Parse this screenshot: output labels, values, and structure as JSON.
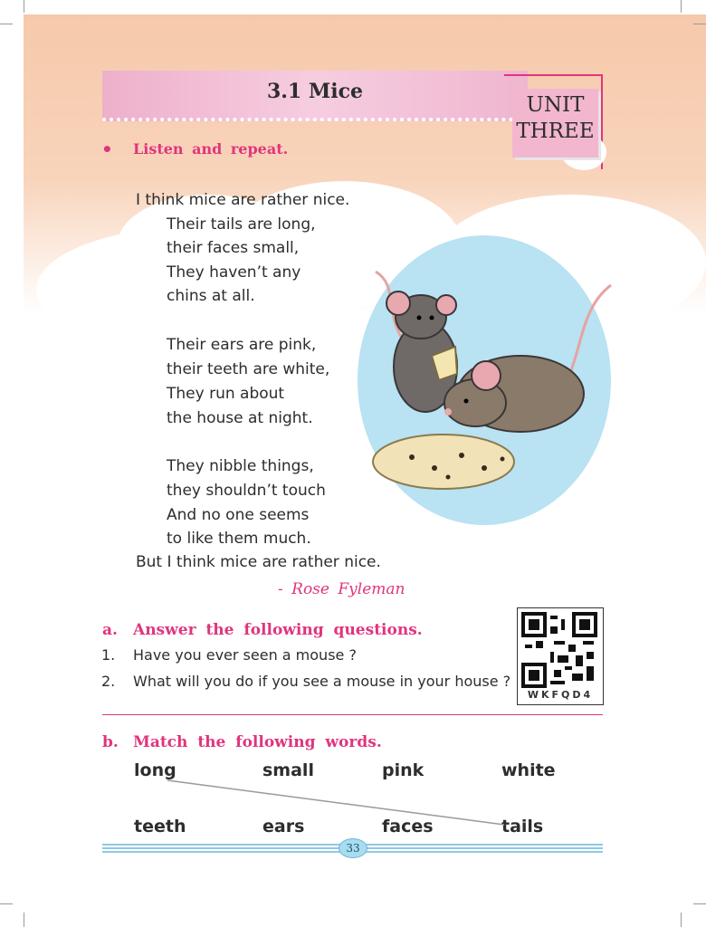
{
  "header": {
    "title": "3.1 Mice",
    "unit_line1": "UNIT",
    "unit_line2": "THREE"
  },
  "instruction": {
    "bullet": "•",
    "text": "Listen and repeat."
  },
  "poem": {
    "lines": [
      "I think mice are rather nice.",
      "Their tails are long,",
      "their faces small,",
      "They haven’t any",
      "chins at all.",
      "Their ears are pink,",
      "their teeth are white,",
      "They run about",
      "the house at night.",
      "They nibble things,",
      "they shouldn’t touch",
      "And no one seems",
      "to like them much.",
      "But I think mice are rather nice."
    ],
    "author": "- Rose Fyleman"
  },
  "section_a": {
    "marker": "a.",
    "heading": "Answer the following questions.",
    "questions": [
      {
        "num": "1.",
        "text": "Have you ever seen a mouse ?"
      },
      {
        "num": "2.",
        "text": "What will you do if you see a mouse in your house ?"
      }
    ],
    "qr_code": "WKFQD4"
  },
  "section_b": {
    "marker": "b.",
    "heading": "Match the following words.",
    "row1": [
      "long",
      "small",
      "pink",
      "white"
    ],
    "row2": [
      "teeth",
      "ears",
      "faces",
      "tails"
    ]
  },
  "footer": {
    "page_number": "33"
  },
  "colors": {
    "accent_pink": "#e0357c",
    "banner_pink": "#f3b6cf",
    "peach": "#f6c9aa",
    "footer_blue": "#8fc9e2"
  }
}
